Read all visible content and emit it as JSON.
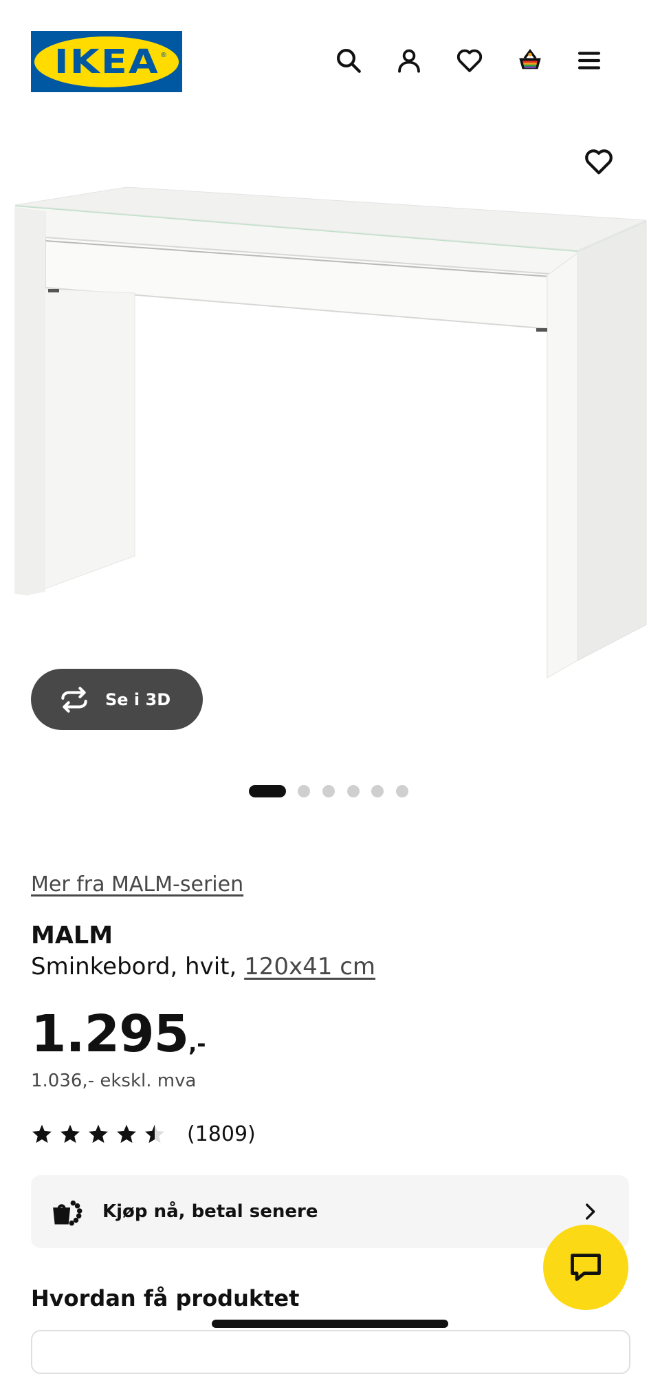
{
  "header": {
    "logo_text": "IKEA",
    "logo_reg": "®",
    "icons": [
      "search-icon",
      "account-icon",
      "favourites-icon",
      "basket-icon",
      "menu-icon"
    ],
    "colors": {
      "brand_blue": "#0058a3",
      "brand_yellow": "#ffdb00"
    }
  },
  "gallery": {
    "view_3d_label": "Se i 3D",
    "dots_total": 6,
    "active_dot": 1
  },
  "product": {
    "series_link": "Mer fra MALM-serien",
    "name": "MALM",
    "description": "Sminkebord, hvit,",
    "size_link": "120x41 cm",
    "price_integer": "1.295",
    "price_suffix": ",-",
    "price_ex_vat": "1.036,- ekskl. mva",
    "rating_value": 4.5,
    "rating_max": 5,
    "rating_count": "(1809)"
  },
  "bnpl": {
    "label": "Kjøp nå, betal senere"
  },
  "delivery": {
    "heading": "Hvordan få produktet"
  },
  "chat": {
    "color": "#fbd914"
  }
}
